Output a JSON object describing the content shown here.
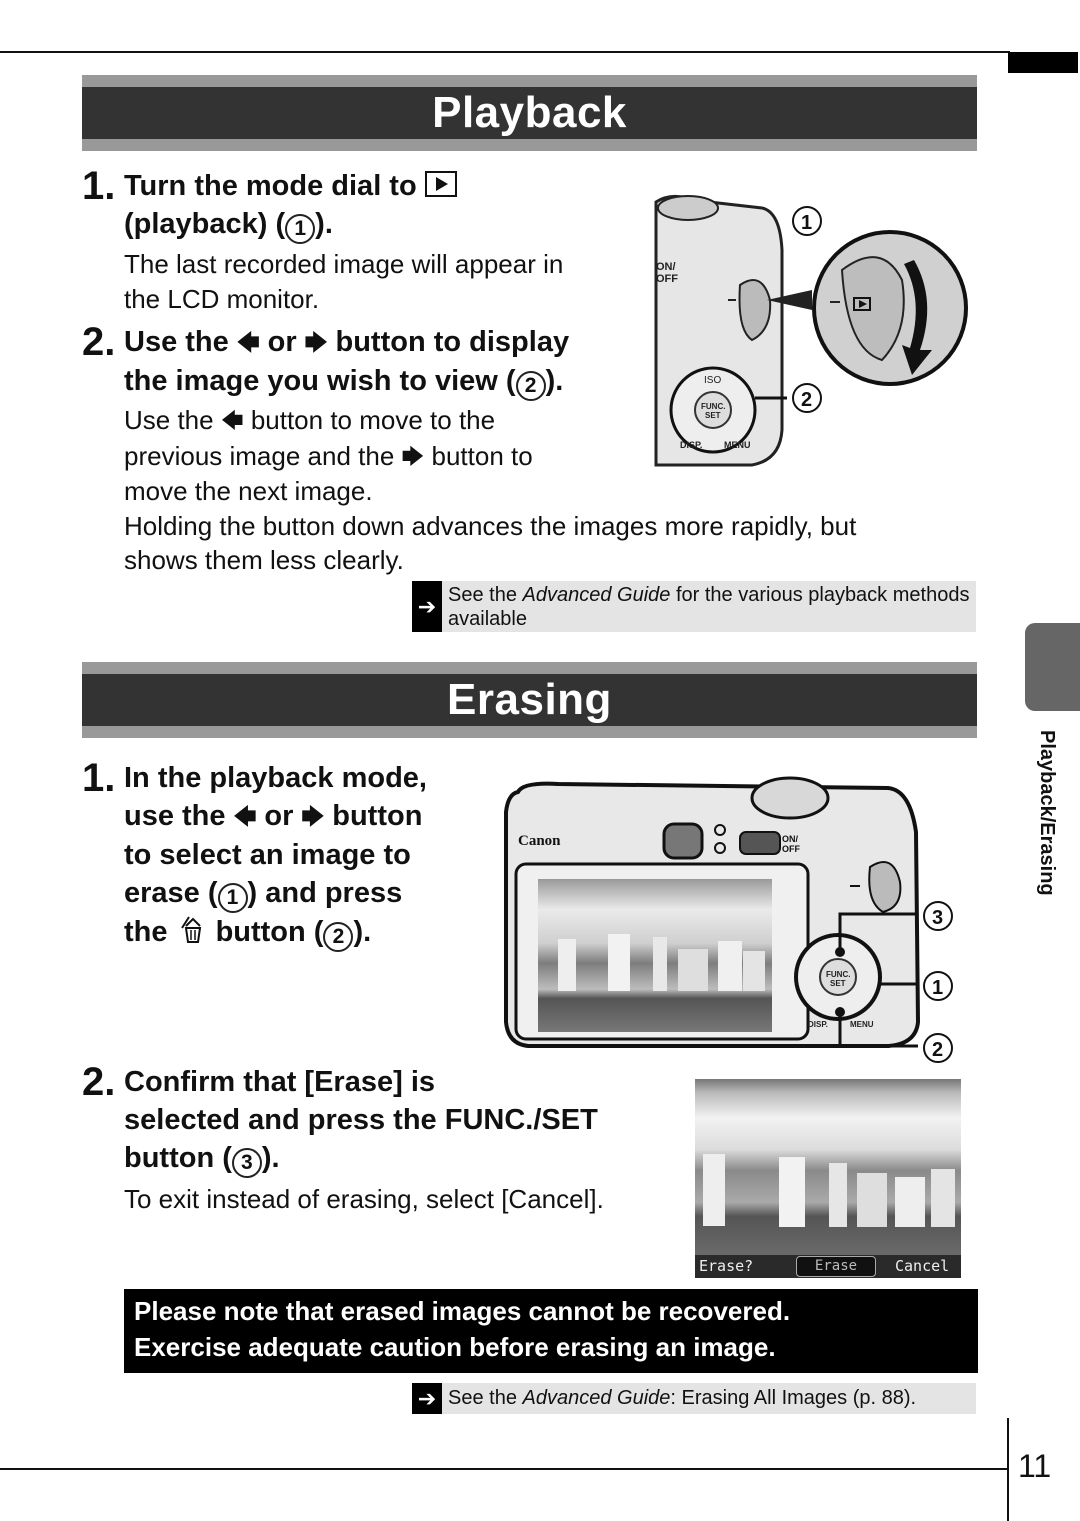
{
  "page": {
    "number": "11",
    "side_tab_label": "Playback/Erasing"
  },
  "playback": {
    "title": "Playback",
    "step1": {
      "num": "1.",
      "title_a": "Turn the mode dial to",
      "title_b": "(playback) (",
      "title_c": ").",
      "circle": "1",
      "body": [
        "The last recorded image will appear in",
        "the LCD monitor."
      ]
    },
    "step2": {
      "num": "2.",
      "title_a": "Use the",
      "title_or": "or",
      "title_b": "button to display",
      "title_c": "the image you wish to view (",
      "title_d": ").",
      "circle": "2",
      "body_a": "Use the",
      "body_b": "button to move to the",
      "body_c": "previous image and the",
      "body_d": "button to",
      "body_e": "move the next image.",
      "body_f": "Holding the button down advances the images more rapidly, but",
      "body_g": "shows them less clearly."
    },
    "reference": {
      "prefix": "See the ",
      "italic": "Advanced Guide",
      "suffix": " for the various playback methods",
      "line2": "available"
    },
    "figure": {
      "callout_1": "1",
      "callout_2": "2",
      "dial_labels": [
        "ON/",
        "OFF",
        "ISO",
        "FUNC.",
        "SET",
        "DISP.",
        "MENU"
      ]
    }
  },
  "erasing": {
    "title": "Erasing",
    "step1": {
      "num": "1.",
      "lines": [
        "In the playback mode,"
      ],
      "line2_a": "use the",
      "line2_or": "or",
      "line2_b": "button",
      "line3": "to select an image to",
      "line4_a": "erase (",
      "line4_b": ") and press",
      "line5_a": "the",
      "line5_b": "button (",
      "line5_c": ").",
      "circle_1": "1",
      "circle_2": "2"
    },
    "step2": {
      "num": "2.",
      "line1": "Confirm that [Erase] is",
      "line2": "selected and press the FUNC./SET",
      "line3_a": "button (",
      "line3_b": ").",
      "circle": "3",
      "body": "To exit instead of erasing, select [Cancel]."
    },
    "figure": {
      "brand": "Canon",
      "callouts": [
        "3",
        "1",
        "2"
      ],
      "labels": [
        "ON/",
        "OFF",
        "FUNC.",
        "SET",
        "DISP.",
        "MENU"
      ]
    },
    "screen": {
      "prompt": "Erase?",
      "erase_label": "Erase",
      "cancel_label": "Cancel"
    },
    "warning": [
      "Please note that erased images cannot be recovered.",
      "Exercise adequate caution before erasing an image."
    ],
    "reference": {
      "prefix": "See the ",
      "italic": "Advanced Guide",
      "suffix": ": Erasing All Images (p. 88)."
    }
  },
  "icons": {
    "left_arrow": "🡄",
    "right_arrow": "🡆",
    "ref_arrow": "➔"
  }
}
